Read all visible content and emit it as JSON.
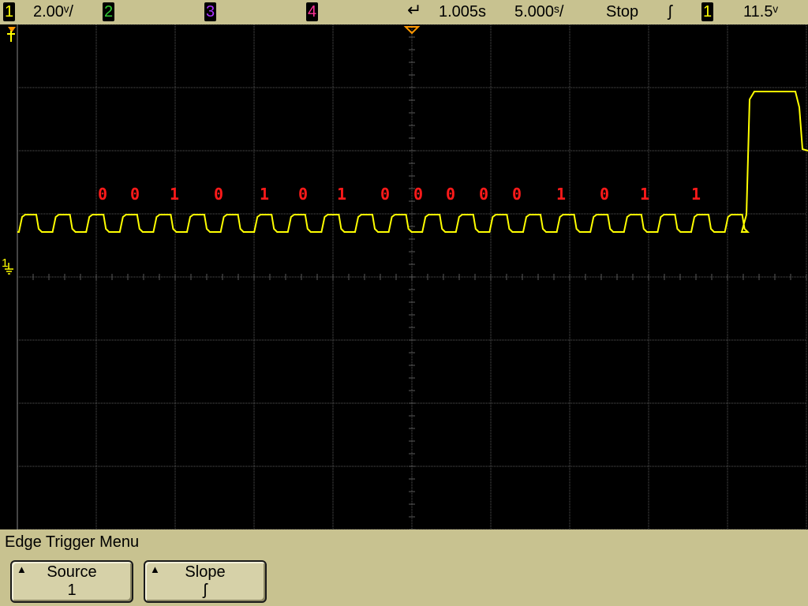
{
  "top_bar": {
    "ch1_label": "1",
    "ch1_scale": "2.00ᵛ/",
    "ch2_label": "2",
    "ch3_label": "3",
    "ch4_label": "4",
    "time_delay": "1.005s",
    "time_scale": "5.000ˢ/",
    "run_state": "Stop",
    "trigger_slope_symbol": "ʃ",
    "trigger_source_label": "1",
    "trigger_level": "11.5ᵛ",
    "colors": {
      "ch1": "#ffff00",
      "ch2": "#33cc33",
      "ch3": "#aa33ff",
      "ch4": "#ff3399"
    }
  },
  "screen": {
    "ground_marker_label": "1",
    "decoded_bits": [
      "0",
      "0",
      "1",
      "0",
      "1",
      "0",
      "1",
      "0",
      "0",
      "0",
      "0",
      "0",
      "1",
      "0",
      "1",
      "1"
    ],
    "bit_color": "#ff1a1a",
    "trace_color": "#ffff00",
    "grid_color": "#5a5a5a"
  },
  "menu": {
    "title": "Edge Trigger Menu",
    "softkeys": [
      {
        "label": "Source",
        "value": "1"
      },
      {
        "label": "Slope",
        "value": "ʃ"
      }
    ]
  }
}
